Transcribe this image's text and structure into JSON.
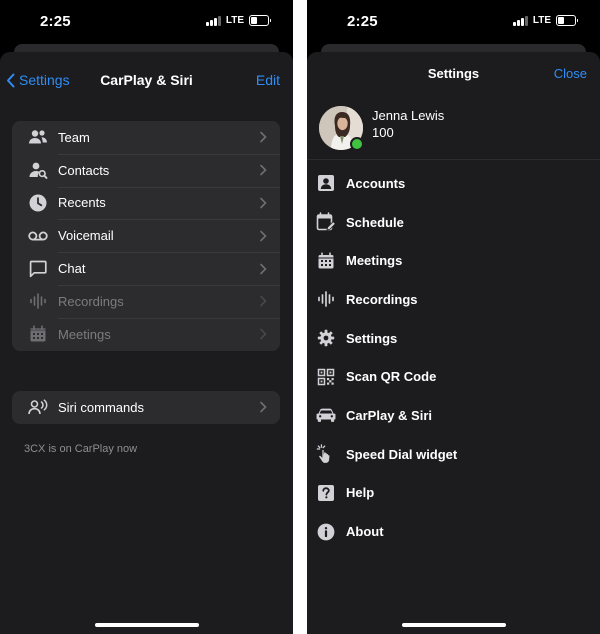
{
  "left": {
    "status": {
      "time": "2:25",
      "network": "LTE"
    },
    "nav": {
      "back_label": "Settings",
      "title": "CarPlay & Siri",
      "edit_label": "Edit"
    },
    "tabs_list": [
      {
        "label": "Team",
        "icon": "team-icon",
        "enabled": true
      },
      {
        "label": "Contacts",
        "icon": "contacts-icon",
        "enabled": true
      },
      {
        "label": "Recents",
        "icon": "recents-icon",
        "enabled": true
      },
      {
        "label": "Voicemail",
        "icon": "voicemail-icon",
        "enabled": true
      },
      {
        "label": "Chat",
        "icon": "chat-icon",
        "enabled": true
      },
      {
        "label": "Recordings",
        "icon": "recordings-icon",
        "enabled": false
      },
      {
        "label": "Meetings",
        "icon": "meetings-icon",
        "enabled": false
      }
    ],
    "siri": {
      "label": "Siri commands",
      "icon": "siri-icon"
    },
    "footnote": "3CX is on CarPlay now"
  },
  "right": {
    "status": {
      "time": "2:25",
      "network": "LTE"
    },
    "header": {
      "title": "Settings",
      "close_label": "Close"
    },
    "profile": {
      "name": "Jenna Lewis",
      "extension": "100",
      "presence": "available"
    },
    "menu": [
      {
        "label": "Accounts",
        "icon": "accounts-icon"
      },
      {
        "label": "Schedule",
        "icon": "schedule-icon"
      },
      {
        "label": "Meetings",
        "icon": "meetings-icon"
      },
      {
        "label": "Recordings",
        "icon": "recordings-icon"
      },
      {
        "label": "Settings",
        "icon": "gear-icon"
      },
      {
        "label": "Scan QR Code",
        "icon": "qr-code-icon"
      },
      {
        "label": "CarPlay & Siri",
        "icon": "car-icon"
      },
      {
        "label": "Speed Dial widget",
        "icon": "speed-dial-icon"
      },
      {
        "label": "Help",
        "icon": "help-icon"
      },
      {
        "label": "About",
        "icon": "info-icon"
      }
    ]
  },
  "colors": {
    "accent": "#2f8df5",
    "sheet": "#1c1c1e",
    "group": "#2c2c2e",
    "disabled_text": "#7c7c80",
    "presence": "#3fc340"
  }
}
